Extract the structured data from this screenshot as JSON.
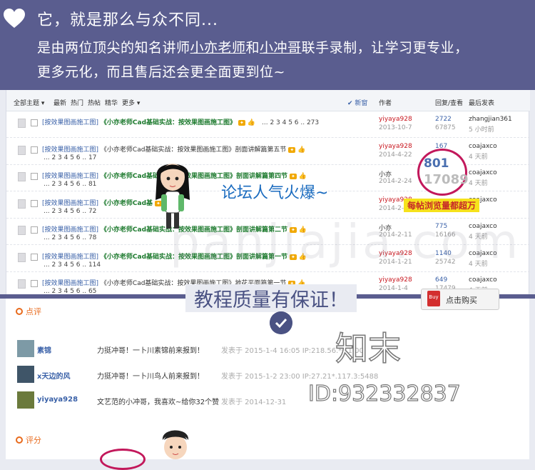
{
  "hero": {
    "line1": "它，就是那么与众不同...",
    "line2_a": "是由两位顶尖的知名讲师",
    "line2_b": "小亦老师",
    "line2_c": "和",
    "line2_d": "小冲哥",
    "line2_e": "联手录制，让学习更专业，",
    "line3": "更多元化，而且售后还会更全面更到位~"
  },
  "forum": {
    "header": {
      "all": "全部主题 ▾",
      "latest": "最新",
      "hot": "热门",
      "hotpost": "热帖",
      "digest": "精华",
      "more": "更多 ▾",
      "new": "✔ 新窗",
      "author": "作者",
      "reply_view": "回复/查看",
      "last": "最后发表"
    },
    "rows": [
      {
        "cat": "[按效果图画施工图]",
        "title": "《小亦老师Cad基础实战：按效果图画施工图》",
        "tag": "",
        "pages": "... 2 3 4 5 6 .. 273",
        "author": "yiyaya928",
        "date": "2013-10-7",
        "replies": "2722",
        "views": "67875",
        "last_user": "zhangjian361",
        "last_time": "5 小时前",
        "style": "green",
        "inline": true
      },
      {
        "cat": "[按效果图画施工图]",
        "title": "《小亦老师Cad基础实战：按效果图画施工图》剖面讲解篇第五节",
        "tag": "",
        "pages": "... 2 3 4 5 6 .. 17",
        "author": "yiyaya928",
        "date": "2014-4-22",
        "replies": "167",
        "views": "",
        "last_user": "coajaxco",
        "last_time": "4 天前",
        "style": "dark",
        "inline": false
      },
      {
        "cat": "[按效果图画施工图]",
        "title": "《小亦老师Cad基础实战：按效果图画施工图》剖面讲解篇第四节",
        "tag": "",
        "pages": "... 2 3 4 5 6 .. 81",
        "author": "小亦",
        "date": "2014-2-24",
        "replies": "",
        "views": "",
        "last_user": "coajaxco",
        "last_time": "4 天前",
        "style": "green",
        "inline": false
      },
      {
        "cat": "[按效果图画施工图]",
        "title": "《小亦老师Cad基",
        "tag": "",
        "pages": "... 2 3 4 5 6 .. 72",
        "author": "yiyaya928",
        "date": "2014-2-21",
        "replies": "",
        "views": "",
        "last_user": "coajaxco",
        "last_time": "",
        "style": "green",
        "inline": false
      },
      {
        "cat": "[按效果图画施工图]",
        "title": "《小亦老师Cad基础实战：按效果图画施工图》剖面讲解篇第二节",
        "tag": "",
        "pages": "... 2 3 4 5 6 .. 78",
        "author": "小亦",
        "date": "2014-2-11",
        "replies": "775",
        "views": "16166",
        "last_user": "coajaxco",
        "last_time": "4 天前",
        "style": "green",
        "inline": false
      },
      {
        "cat": "[按效果图画施工图]",
        "title": "《小亦老师Cad基础实战：按效果图画施工图》剖面讲解篇第一节",
        "tag": "",
        "pages": "... 2 3 4 5 6 .. 114",
        "author": "yiyaya928",
        "date": "2014-1-21",
        "replies": "1140",
        "views": "25742",
        "last_user": "coajaxco",
        "last_time": "4 天前",
        "style": "green",
        "inline": false
      },
      {
        "cat": "[按效果图画施工图]",
        "title": "《小亦老师Cad基础实战：按效果图画施工图》地花平面篇第一节",
        "tag": "",
        "pages": "... 2 3 4 5 6 .. 65",
        "author": "yiyaya928",
        "date": "2014-1-4",
        "replies": "649",
        "views": "17479",
        "last_user": "coajaxco",
        "last_time": "4 天前",
        "style": "dark",
        "inline": false
      }
    ],
    "highlight": {
      "replies": "801",
      "views": "17089"
    },
    "popular": "论坛人气火爆~",
    "views_badge": "每帖浏览量都超万"
  },
  "quality": "教程质量有保证！",
  "buy": {
    "badge": "Buy",
    "label": "点击购买"
  },
  "comments": {
    "section": "点评",
    "items": [
      {
        "user": "素锦",
        "text": "力挺冲哥！一卜川素锦前来报到！",
        "meta": "发表于 2015-1-4 16:05 IP:218.56.**.1:00:"
      },
      {
        "user": "x天边的风",
        "text": "力挺冲哥！一卜川鸟人前来报到！",
        "meta": "发表于 2015-1-2 23:00 IP:27.21*.117.3:5488"
      },
      {
        "user": "yiyaya928",
        "text": "文艺范的小冲哥，我喜欢~给你32个赞",
        "meta": "发表于 2014-12-31"
      }
    ],
    "section2": "评分"
  },
  "watermark": {
    "brand": "知末",
    "id": "ID:932332837",
    "faint": "panjiajia.com"
  }
}
